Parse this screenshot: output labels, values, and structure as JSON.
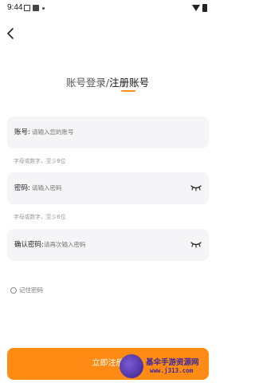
{
  "status_bar": {
    "time": "9:44"
  },
  "tabs": {
    "login": "账号登录",
    "separator": "/",
    "register": "注册账号"
  },
  "account": {
    "label": "账号:",
    "placeholder": "请输入您的账号",
    "hint": "字母或数字，至少8位"
  },
  "password": {
    "label": "密码:",
    "placeholder": "请输入密码",
    "hint": "字母或数字，至少6位"
  },
  "confirm": {
    "label": "确认密码:",
    "placeholder": "请再次输入密码"
  },
  "remember": {
    "label": "记住密码"
  },
  "submit": {
    "label": "立即注册"
  },
  "watermark": {
    "line1": "基伞手游资源网",
    "line2": "www.j313.com"
  },
  "colors": {
    "accent": "#ff8a14",
    "field_bg": "#f5f5f7"
  },
  "icons": {
    "back": "back-arrow-icon",
    "eye": "eye-closed-icon"
  }
}
